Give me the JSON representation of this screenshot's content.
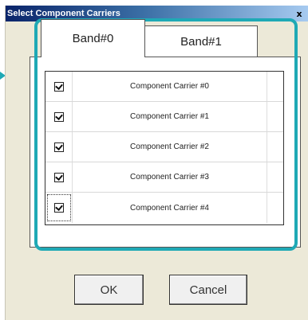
{
  "window": {
    "title": "Select Component Carriers",
    "close_glyph": "x"
  },
  "tabs": [
    {
      "label": "Band#0",
      "selected": true
    },
    {
      "label": "Band#1",
      "selected": false
    }
  ],
  "carriers": [
    {
      "label": "Component Carrier #0",
      "checked": true
    },
    {
      "label": "Component Carrier #1",
      "checked": true
    },
    {
      "label": "Component Carrier #2",
      "checked": true
    },
    {
      "label": "Component Carrier #3",
      "checked": true
    },
    {
      "label": "Component Carrier #4",
      "checked": true
    }
  ],
  "buttons": {
    "ok_label": "OK",
    "cancel_label": "Cancel"
  },
  "colors": {
    "highlight": "#1fa9b5",
    "titlebar_start": "#0a246a",
    "dialog_bg": "#ece9d8"
  }
}
